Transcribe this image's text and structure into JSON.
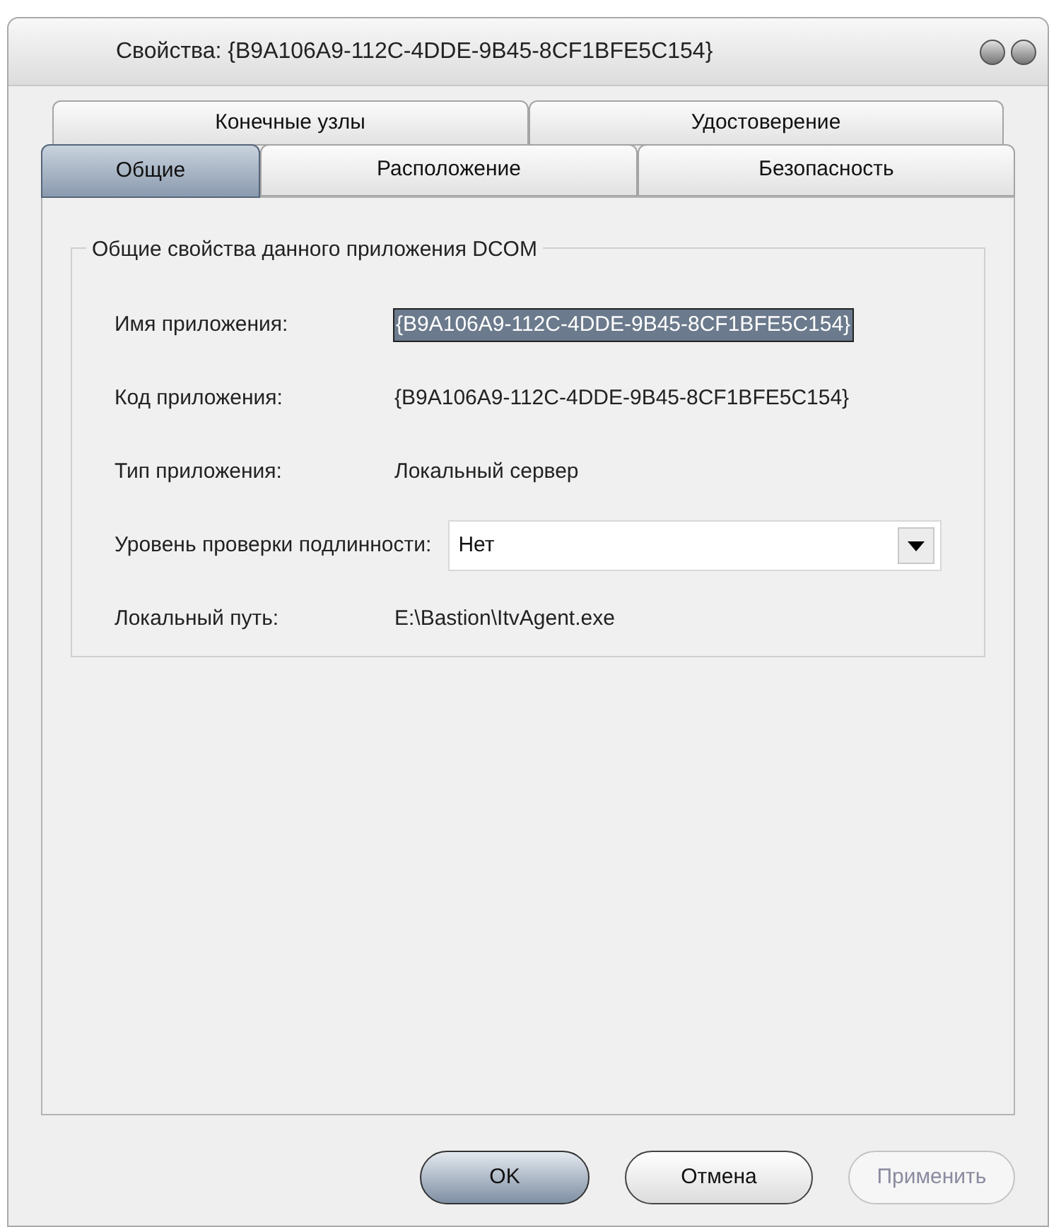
{
  "window": {
    "title": "Свойства: {B9A106A9-112C-4DDE-9B45-8CF1BFE5C154}"
  },
  "tabs": [
    [
      {
        "label": "Конечные узлы",
        "selected": false
      },
      {
        "label": "Удостоверение",
        "selected": false
      }
    ],
    [
      {
        "label": "Общие",
        "selected": true
      },
      {
        "label": "Расположение",
        "selected": false
      },
      {
        "label": "Безопасность",
        "selected": false
      }
    ]
  ],
  "group": {
    "title": "Общие свойства данного приложения DCOM",
    "fields": [
      {
        "kind": "text",
        "label": "Имя приложения:",
        "value": "{B9A106A9-112C-4DDE-9B45-8CF1BFE5C154}",
        "highlighted": true
      },
      {
        "kind": "text",
        "label": "Код приложения:",
        "value": "{B9A106A9-112C-4DDE-9B45-8CF1BFE5C154}",
        "highlighted": false
      },
      {
        "kind": "text",
        "label": "Тип приложения:",
        "value": "Локальный сервер",
        "highlighted": false
      },
      {
        "kind": "dropdown",
        "label": "Уровень проверки подлинности:",
        "value": "Нет"
      },
      {
        "kind": "text",
        "label": "Локальный путь:",
        "value": "E:\\Bastion\\ItvAgent.exe",
        "highlighted": false
      }
    ]
  },
  "buttons": [
    {
      "label": "OK",
      "default": true,
      "disabled": false
    },
    {
      "label": "Отмена",
      "default": false,
      "disabled": false
    },
    {
      "label": "Применить",
      "default": false,
      "disabled": true
    }
  ]
}
